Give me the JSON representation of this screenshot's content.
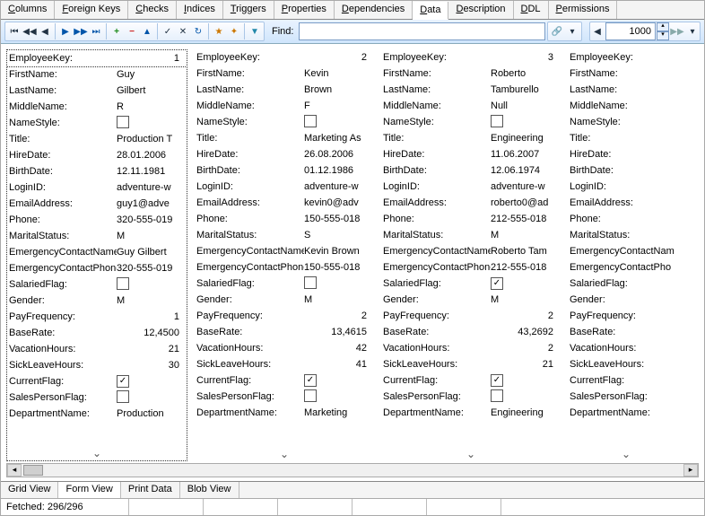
{
  "topTabs": [
    {
      "label": "Columns",
      "u": "C"
    },
    {
      "label": "Foreign Keys",
      "u": "K"
    },
    {
      "label": "Checks",
      "u": "C"
    },
    {
      "label": "Indices",
      "u": "I"
    },
    {
      "label": "Triggers",
      "u": "T"
    },
    {
      "label": "Properties",
      "u": "P"
    },
    {
      "label": "Dependencies",
      "u": "D"
    },
    {
      "label": "Data",
      "u": "D",
      "active": true
    },
    {
      "label": "Description",
      "u": "D"
    },
    {
      "label": "DDL",
      "u": "D"
    },
    {
      "label": "Permissions",
      "u": "P"
    }
  ],
  "toolbar": {
    "findLabel": "Find:",
    "spinValue": "1000"
  },
  "fields": [
    {
      "key": "EmployeeKey",
      "label": "EmployeeKey:",
      "num": true
    },
    {
      "key": "FirstName",
      "label": "FirstName:"
    },
    {
      "key": "LastName",
      "label": "LastName:"
    },
    {
      "key": "MiddleName",
      "label": "MiddleName:"
    },
    {
      "key": "NameStyle",
      "label": "NameStyle:",
      "chk": true
    },
    {
      "key": "Title",
      "label": "Title:"
    },
    {
      "key": "HireDate",
      "label": "HireDate:"
    },
    {
      "key": "BirthDate",
      "label": "BirthDate:"
    },
    {
      "key": "LoginID",
      "label": "LoginID:"
    },
    {
      "key": "EmailAddress",
      "label": "EmailAddress:"
    },
    {
      "key": "Phone",
      "label": "Phone:"
    },
    {
      "key": "MaritalStatus",
      "label": "MaritalStatus:"
    },
    {
      "key": "EmergencyContactName",
      "label": "EmergencyContactName:"
    },
    {
      "key": "EmergencyContactPhone",
      "label": "EmergencyContactPhone:"
    },
    {
      "key": "SalariedFlag",
      "label": "SalariedFlag:",
      "chk": true
    },
    {
      "key": "Gender",
      "label": "Gender:"
    },
    {
      "key": "PayFrequency",
      "label": "PayFrequency:",
      "num": true
    },
    {
      "key": "BaseRate",
      "label": "BaseRate:",
      "num": true
    },
    {
      "key": "VacationHours",
      "label": "VacationHours:",
      "num": true
    },
    {
      "key": "SickLeaveHours",
      "label": "SickLeaveHours:",
      "num": true
    },
    {
      "key": "CurrentFlag",
      "label": "CurrentFlag:",
      "chk": true
    },
    {
      "key": "SalesPersonFlag",
      "label": "SalesPersonFlag:",
      "chk": true
    },
    {
      "key": "DepartmentName",
      "label": "DepartmentName:"
    }
  ],
  "records": [
    {
      "selected": true,
      "values": {
        "EmployeeKey": "1",
        "FirstName": "Guy",
        "LastName": "Gilbert",
        "MiddleName": "R",
        "NameStyle": false,
        "Title": "Production T",
        "HireDate": "28.01.2006",
        "BirthDate": "12.11.1981",
        "LoginID": "adventure-w",
        "EmailAddress": "guy1@adve",
        "Phone": "320-555-019",
        "MaritalStatus": "M",
        "EmergencyContactName": "Guy Gilbert",
        "EmergencyContactPhone": "320-555-019",
        "SalariedFlag": false,
        "Gender": "M",
        "PayFrequency": "1",
        "BaseRate": "12,4500",
        "VacationHours": "21",
        "SickLeaveHours": "30",
        "CurrentFlag": true,
        "SalesPersonFlag": false,
        "DepartmentName": "Production"
      }
    },
    {
      "values": {
        "EmployeeKey": "2",
        "FirstName": "Kevin",
        "LastName": "Brown",
        "MiddleName": "F",
        "NameStyle": false,
        "Title": "Marketing As",
        "HireDate": "26.08.2006",
        "BirthDate": "01.12.1986",
        "LoginID": "adventure-w",
        "EmailAddress": "kevin0@adv",
        "Phone": "150-555-018",
        "MaritalStatus": "S",
        "EmergencyContactName": "Kevin Brown",
        "EmergencyContactPhone": "150-555-018",
        "SalariedFlag": false,
        "Gender": "M",
        "PayFrequency": "2",
        "BaseRate": "13,4615",
        "VacationHours": "42",
        "SickLeaveHours": "41",
        "CurrentFlag": true,
        "SalesPersonFlag": false,
        "DepartmentName": "Marketing"
      }
    },
    {
      "values": {
        "EmployeeKey": "3",
        "FirstName": "Roberto",
        "LastName": "Tamburello",
        "MiddleName": "Null",
        "NameStyle": false,
        "Title": "Engineering",
        "HireDate": "11.06.2007",
        "BirthDate": "12.06.1974",
        "LoginID": "adventure-w",
        "EmailAddress": "roberto0@ad",
        "Phone": "212-555-018",
        "MaritalStatus": "M",
        "EmergencyContactName": "Roberto Tam",
        "EmergencyContactPhone": "212-555-018",
        "SalariedFlag": true,
        "Gender": "M",
        "PayFrequency": "2",
        "BaseRate": "43,2692",
        "VacationHours": "2",
        "SickLeaveHours": "21",
        "CurrentFlag": true,
        "SalesPersonFlag": false,
        "DepartmentName": "Engineering"
      }
    },
    {
      "partial": true,
      "values": {
        "EmployeeKey": "",
        "FirstName": "",
        "LastName": "",
        "MiddleName": "",
        "NameStyle": false,
        "Title": "",
        "HireDate": "",
        "BirthDate": "",
        "LoginID": "",
        "EmailAddress": "",
        "Phone": "",
        "MaritalStatus": "",
        "EmergencyContactName": "",
        "EmergencyContactPhone": "",
        "SalariedFlag": false,
        "Gender": "",
        "PayFrequency": "",
        "BaseRate": "",
        "VacationHours": "",
        "SickLeaveHours": "",
        "CurrentFlag": false,
        "SalesPersonFlag": false,
        "DepartmentName": ""
      }
    }
  ],
  "partialLabels": {
    "EmergencyContactName": "EmergencyContactNam",
    "EmergencyContactPhone": "EmergencyContactPho",
    "SalesPersonFlag": "SalesPersonFlag:",
    "CurrentFlag": "CurrentFlag:",
    "SickLeaveHours": "SickLeaveHours:"
  },
  "bottomTabs": [
    {
      "label": "Grid View"
    },
    {
      "label": "Form View",
      "active": true
    },
    {
      "label": "Print Data"
    },
    {
      "label": "Blob View"
    }
  ],
  "status": {
    "fetched": "Fetched: 296/296"
  }
}
